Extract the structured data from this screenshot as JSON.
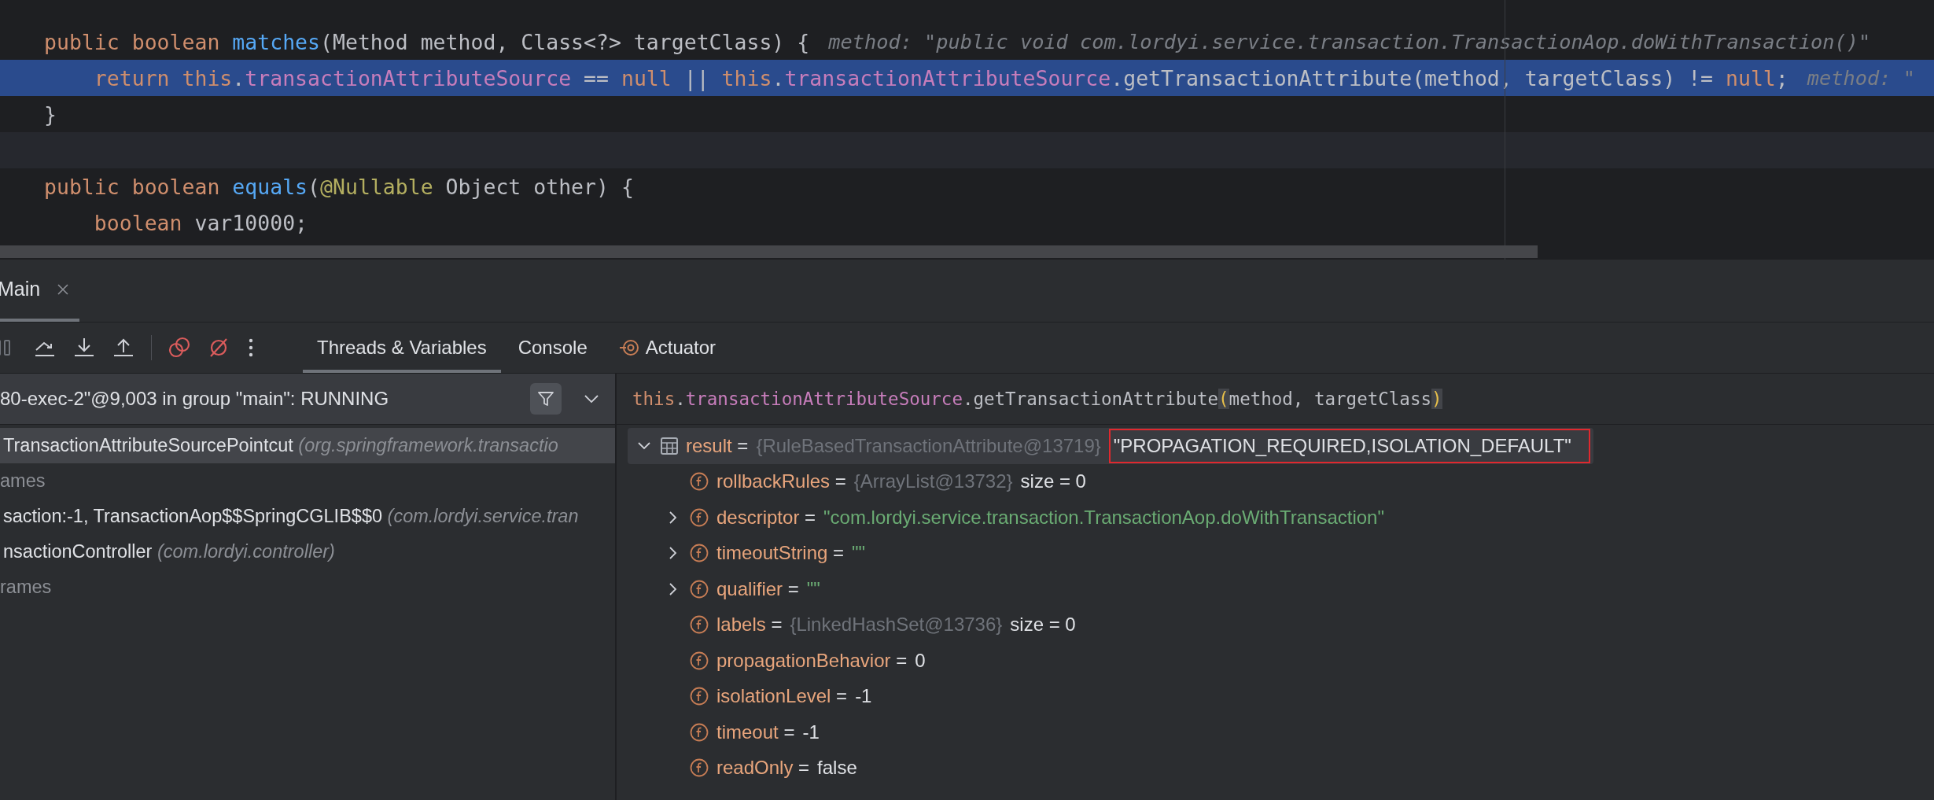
{
  "editor": {
    "lines": [
      {
        "executing": false,
        "current": false,
        "segments": [
          {
            "text": "public boolean ",
            "kind": "keyword"
          },
          {
            "text": "matches",
            "kind": "method"
          },
          {
            "text": "(Method method, Class<?> targetClass) {",
            "kind": "plain"
          }
        ],
        "hint": "method: \"public void com.lordyi.service.transaction.TransactionAop.doWithTransaction()\""
      },
      {
        "executing": true,
        "current": false,
        "segments": [
          {
            "text": "    return ",
            "kind": "keyword"
          },
          {
            "text": "this",
            "kind": "keyword"
          },
          {
            "text": ".",
            "kind": "plain"
          },
          {
            "text": "transactionAttributeSource",
            "kind": "field"
          },
          {
            "text": " == ",
            "kind": "plain"
          },
          {
            "text": "null",
            "kind": "keyword"
          },
          {
            "text": " || ",
            "kind": "plain"
          },
          {
            "text": "this",
            "kind": "keyword"
          },
          {
            "text": ".",
            "kind": "plain"
          },
          {
            "text": "transactionAttributeSource",
            "kind": "field"
          },
          {
            "text": ".getTransactionAttribute(method, targetClass) != ",
            "kind": "plain"
          },
          {
            "text": "null",
            "kind": "keyword"
          },
          {
            "text": ";",
            "kind": "plain"
          }
        ],
        "hint": "method: \""
      },
      {
        "executing": false,
        "current": false,
        "segments": [
          {
            "text": "}",
            "kind": "plain"
          }
        ]
      },
      {
        "executing": false,
        "current": true
      },
      {
        "executing": false,
        "current": false,
        "segments": [
          {
            "text": "public boolean ",
            "kind": "keyword"
          },
          {
            "text": "equals",
            "kind": "method"
          },
          {
            "text": "(",
            "kind": "plain"
          },
          {
            "text": "@Nullable",
            "kind": "annotation"
          },
          {
            "text": " Object other) {",
            "kind": "plain"
          }
        ]
      },
      {
        "executing": false,
        "current": false,
        "segments": [
          {
            "text": "    boolean",
            "kind": "keyword"
          },
          {
            "text": " var10000;",
            "kind": "plain"
          }
        ]
      }
    ]
  },
  "debug_tabs": [
    {
      "label": "Main",
      "selected": true,
      "closable": true
    }
  ],
  "view_tabs": [
    {
      "label": "Threads & Variables",
      "selected": true
    },
    {
      "label": "Console",
      "selected": false
    },
    {
      "label": "Actuator",
      "selected": false,
      "kind": "actuator"
    }
  ],
  "thread_selector": {
    "text": "80-exec-2\"@9,003 in group \"main\": RUNNING"
  },
  "frames": [
    {
      "kind": "frame",
      "method": "TransactionAttributeSourcePointcut",
      "location": "(org.springframework.transactio",
      "selected": true
    },
    {
      "kind": "group",
      "text": "ames"
    },
    {
      "kind": "frame",
      "method": "saction:-1, TransactionAop$$SpringCGLIB$$0",
      "location": "(com.lordyi.service.tran",
      "selected": false
    },
    {
      "kind": "frame",
      "method": "nsactionController",
      "location": "(com.lordyi.controller)",
      "selected": false
    },
    {
      "kind": "group",
      "text": "rames"
    }
  ],
  "watch_expression": {
    "segments": [
      {
        "text": "this",
        "kind": "keyword"
      },
      {
        "text": ".",
        "kind": "plain"
      },
      {
        "text": "transactionAttributeSource",
        "kind": "field"
      },
      {
        "text": ".getTransactionAttribute",
        "kind": "plain"
      },
      {
        "text": "(",
        "kind": "brace"
      },
      {
        "text": "method, targetClass",
        "kind": "plain"
      },
      {
        "text": ")",
        "kind": "brace"
      }
    ]
  },
  "variables": [
    {
      "name": "result",
      "operator": "=",
      "kind": "local",
      "type": "{RuleBasedTransactionAttribute@13719}",
      "value": "\"PROPAGATION_REQUIRED,ISOLATION_DEFAULT\"",
      "string": false,
      "expandable": true,
      "expanded": true,
      "selected": true,
      "outlined": true,
      "children": [
        {
          "name": "rollbackRules",
          "operator": "=",
          "kind": "field",
          "type": "{ArrayList@13732}",
          "value": "size = 0",
          "string": false,
          "expandable": false,
          "selected": false
        },
        {
          "name": "descriptor",
          "operator": "=",
          "kind": "field",
          "value": "\"com.lordyi.service.transaction.TransactionAop.doWithTransaction\"",
          "string": true,
          "expandable": true,
          "expanded": false,
          "selected": false
        },
        {
          "name": "timeoutString",
          "operator": "=",
          "kind": "field",
          "value": "\"\"",
          "string": true,
          "expandable": true,
          "expanded": false,
          "selected": false
        },
        {
          "name": "qualifier",
          "operator": "=",
          "kind": "field",
          "value": "\"\"",
          "string": true,
          "expandable": true,
          "expanded": false,
          "selected": false
        },
        {
          "name": "labels",
          "operator": "=",
          "kind": "field",
          "type": "{LinkedHashSet@13736}",
          "value": "size = 0",
          "string": false,
          "expandable": false,
          "selected": false
        },
        {
          "name": "propagationBehavior",
          "operator": "=",
          "kind": "field",
          "value": "0",
          "string": false,
          "expandable": false,
          "selected": false
        },
        {
          "name": "isolationLevel",
          "operator": "=",
          "kind": "field",
          "value": "-1",
          "string": false,
          "expandable": false,
          "selected": false
        },
        {
          "name": "timeout",
          "operator": "=",
          "kind": "field",
          "value": "-1",
          "string": false,
          "expandable": false,
          "selected": false
        },
        {
          "name": "readOnly",
          "operator": "=",
          "kind": "field",
          "value": "false",
          "string": false,
          "expandable": false,
          "selected": false
        }
      ]
    }
  ]
}
